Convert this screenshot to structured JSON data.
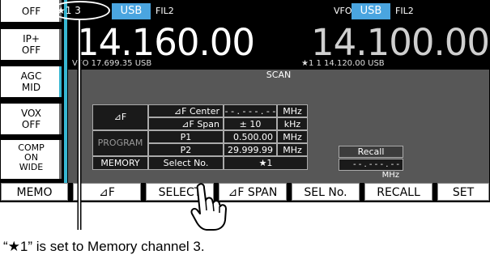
{
  "left_keys": [
    {
      "line1": "OFF",
      "line2": ""
    },
    {
      "line1": "IP+",
      "line2": "OFF"
    },
    {
      "line1": "AGC",
      "line2": "MID"
    },
    {
      "line1": "VOX",
      "line2": "OFF"
    },
    {
      "line1": "COMP",
      "line2": "ON",
      "line3": "WIDE"
    }
  ],
  "main_vfo": {
    "memory_channel": "★1 3",
    "mode": "USB",
    "filter": "FIL2",
    "frequency": "14.160.00",
    "sub_info": "VFO 17.699.35 USB"
  },
  "sub_vfo": {
    "label": "VFO",
    "mode": "USB",
    "filter": "FIL2",
    "frequency": "14.100.00",
    "sub_info": "★1   1  14.120.00  USB"
  },
  "scan_panel": {
    "title": "SCAN",
    "rows": {
      "df_label": "⊿F",
      "df_center_label": "⊿F Center",
      "df_center_value": "- - . - - - . - -",
      "df_center_unit": "MHz",
      "df_span_label": "⊿F Span",
      "df_span_value": "±   10",
      "df_span_unit": "kHz",
      "program_label": "PROGRAM",
      "p1_label": "P1",
      "p1_value": "0.500.00",
      "p1_unit": "MHz",
      "p2_label": "P2",
      "p2_value": "29.999.99",
      "p2_unit": "MHz",
      "memory_label": "MEMORY",
      "select_no_label": "Select No.",
      "select_no_value": "★1"
    },
    "recall_label": "Recall",
    "recall_value": "- - . - - - . - -   MHz"
  },
  "function_keys": [
    "MEMO",
    "⊿F",
    "SELECT",
    "⊿F SPAN",
    "SEL No.",
    "RECALL",
    "SET"
  ],
  "caption": "“★1” is set to Memory channel 3.",
  "colors": {
    "accent": "#4aa5e0",
    "screen_bg": "#000000",
    "panel_bg": "#575757"
  }
}
